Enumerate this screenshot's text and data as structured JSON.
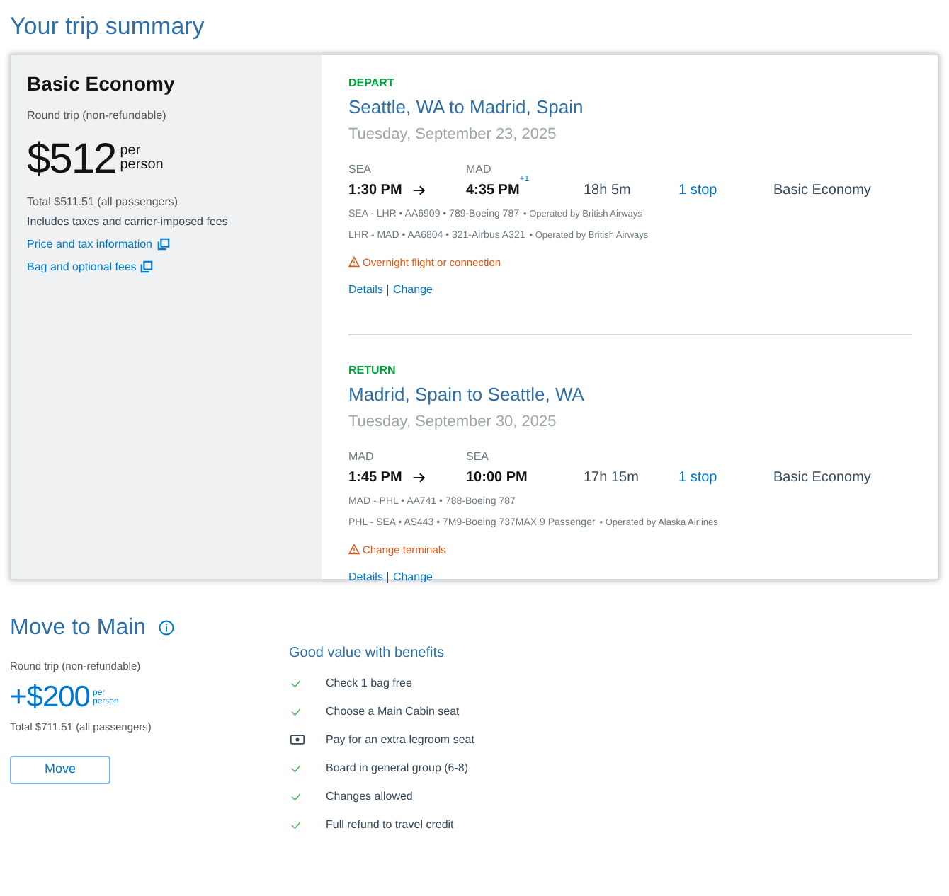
{
  "page_title": "Your trip summary",
  "fare": {
    "name": "Basic Economy",
    "trip_type": "Round trip (non-refundable)",
    "price": "$512",
    "per": "per",
    "person": "person",
    "total": "Total $511.51 (all passengers)",
    "note": "Includes taxes and carrier-imposed fees",
    "links": [
      "Price and tax information",
      "Bag and optional fees"
    ]
  },
  "flights": [
    {
      "label": "DEPART",
      "route": "Seattle, WA to Madrid, Spain",
      "date": "Tuesday, September 23, 2025",
      "from_code": "SEA",
      "to_code": "MAD",
      "depart_time": "1:30 PM",
      "arrive_time": "4:35 PM",
      "day_offset": "+1",
      "duration": "18h 5m",
      "stops": "1 stop",
      "cabin": "Basic Economy",
      "segments": [
        {
          "text": "SEA - LHR • AA6909 • 789-Boeing 787",
          "operator": "• Operated by British Airways"
        },
        {
          "text": "LHR - MAD • AA6804 • 321-Airbus A321",
          "operator": "• Operated by British Airways"
        }
      ],
      "warning": "Overnight flight or connection",
      "links": [
        "Details",
        "Change"
      ]
    },
    {
      "label": "RETURN",
      "route": "Madrid, Spain to Seattle, WA",
      "date": "Tuesday, September 30, 2025",
      "from_code": "MAD",
      "to_code": "SEA",
      "depart_time": "1:45 PM",
      "arrive_time": "10:00 PM",
      "duration": "17h 15m",
      "stops": "1 stop",
      "cabin": "Basic Economy",
      "segments": [
        {
          "text": "MAD - PHL • AA741 • 788-Boeing 787"
        },
        {
          "text": "PHL - SEA • AS443 • 7M9-Boeing 737MAX 9 Passenger",
          "operator": "• Operated by Alaska Airlines"
        }
      ],
      "warning": "Change terminals",
      "links": [
        "Details",
        "Change"
      ]
    }
  ],
  "upgrade": {
    "title": "Move to Main",
    "trip_type": "Round trip (non-refundable)",
    "price": "+$200",
    "per": "per",
    "person": "person",
    "total": "Total $711.51 (all passengers)",
    "button": "Move",
    "benefits_title": "Good value with benefits",
    "benefits": [
      {
        "kind": "included",
        "text": "Check 1 bag free"
      },
      {
        "kind": "included",
        "text": "Choose a Main Cabin seat"
      },
      {
        "kind": "paid",
        "text": "Pay for an extra legroom seat"
      },
      {
        "kind": "included",
        "text": "Board in general group (6-8)"
      },
      {
        "kind": "included",
        "text": "Changes allowed"
      },
      {
        "kind": "included",
        "text": "Full refund to travel credit"
      }
    ]
  }
}
